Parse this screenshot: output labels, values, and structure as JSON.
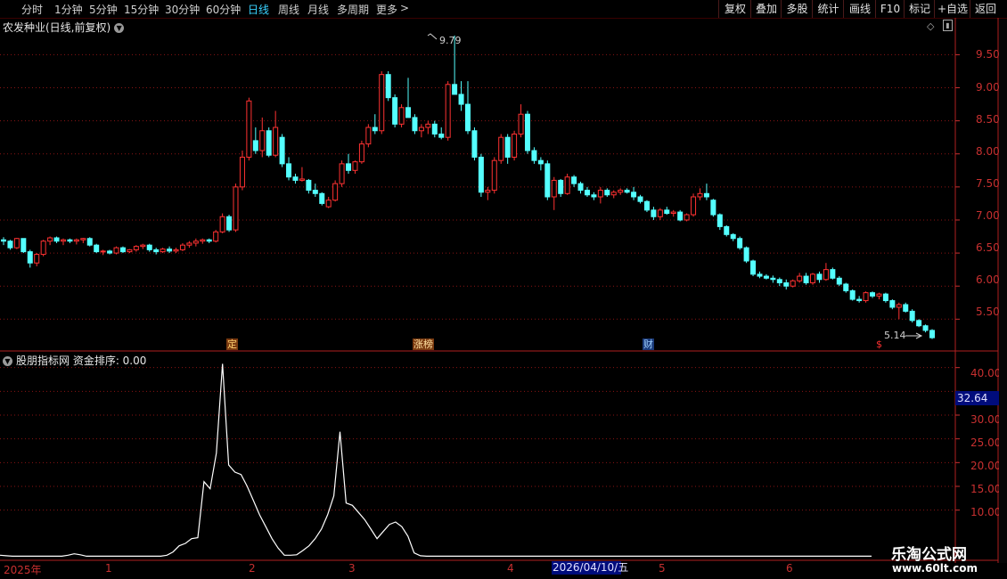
{
  "toolbar": {
    "periods": [
      "分时",
      "1分钟",
      "5分钟",
      "15分钟",
      "30分钟",
      "60分钟",
      "日线",
      "周线",
      "月线",
      "多周期",
      "更多"
    ],
    "active_period": "日线",
    "more_arrow": ">",
    "right_buttons": [
      "复权",
      "叠加",
      "多股",
      "统计",
      "画线",
      "F10",
      "标记",
      "+自选",
      "返回"
    ]
  },
  "chart": {
    "title": "农发种业(日线,前复权)",
    "price_labels": [
      "9.50",
      "9.00",
      "8.50",
      "8.00",
      "7.50",
      "7.00",
      "6.50",
      "6.00",
      "5.50"
    ],
    "high_label": "9.79",
    "low_label": "5.14",
    "events": [
      "定",
      "涨榜",
      "财",
      "$"
    ],
    "up_color": "#ff3232",
    "down_color": "#54ffff",
    "chart_data": {
      "type": "candlestick",
      "series": [
        {
          "ohlc": [
            [
              6.7,
              6.74,
              6.62,
              6.68
            ],
            [
              6.68,
              6.7,
              6.55,
              6.58
            ],
            [
              6.58,
              6.73,
              6.56,
              6.72
            ],
            [
              6.72,
              6.72,
              6.5,
              6.52
            ],
            [
              6.52,
              6.55,
              6.28,
              6.35
            ],
            [
              6.35,
              6.5,
              6.3,
              6.48
            ],
            [
              6.48,
              6.7,
              6.45,
              6.68
            ],
            [
              6.68,
              6.75,
              6.62,
              6.73
            ],
            [
              6.73,
              6.75,
              6.65,
              6.68
            ],
            [
              6.68,
              6.72,
              6.62,
              6.7
            ],
            [
              6.7,
              6.72,
              6.65,
              6.68
            ],
            [
              6.68,
              6.72,
              6.63,
              6.7
            ],
            [
              6.7,
              6.73,
              6.65,
              6.72
            ],
            [
              6.72,
              6.74,
              6.6,
              6.62
            ],
            [
              6.62,
              6.64,
              6.5,
              6.52
            ],
            [
              6.52,
              6.55,
              6.47,
              6.53
            ],
            [
              6.53,
              6.55,
              6.48,
              6.5
            ],
            [
              6.5,
              6.6,
              6.48,
              6.58
            ],
            [
              6.58,
              6.6,
              6.5,
              6.52
            ],
            [
              6.52,
              6.56,
              6.5,
              6.55
            ],
            [
              6.55,
              6.62,
              6.52,
              6.6
            ],
            [
              6.6,
              6.64,
              6.56,
              6.62
            ],
            [
              6.62,
              6.64,
              6.52,
              6.55
            ],
            [
              6.55,
              6.58,
              6.48,
              6.52
            ],
            [
              6.52,
              6.58,
              6.5,
              6.56
            ],
            [
              6.56,
              6.6,
              6.5,
              6.53
            ],
            [
              6.53,
              6.58,
              6.5,
              6.55
            ],
            [
              6.55,
              6.65,
              6.53,
              6.62
            ],
            [
              6.62,
              6.68,
              6.58,
              6.65
            ],
            [
              6.65,
              6.72,
              6.6,
              6.68
            ],
            [
              6.68,
              6.72,
              6.64,
              6.7
            ],
            [
              6.7,
              6.72,
              6.65,
              6.68
            ],
            [
              6.68,
              6.85,
              6.66,
              6.82
            ],
            [
              6.82,
              7.1,
              6.8,
              7.05
            ],
            [
              7.05,
              7.08,
              6.82,
              6.85
            ],
            [
              6.85,
              7.55,
              6.82,
              7.5
            ],
            [
              7.5,
              8.05,
              7.45,
              7.95
            ],
            [
              7.95,
              8.85,
              7.9,
              8.8
            ],
            [
              8.2,
              8.4,
              8.0,
              8.05
            ],
            [
              8.05,
              8.55,
              7.95,
              8.35
            ],
            [
              8.35,
              8.4,
              7.95,
              7.98
            ],
            [
              7.98,
              8.65,
              7.95,
              8.4
            ],
            [
              8.25,
              8.3,
              7.8,
              7.85
            ],
            [
              7.85,
              7.95,
              7.6,
              7.65
            ],
            [
              7.65,
              7.7,
              7.55,
              7.6
            ],
            [
              7.6,
              7.8,
              7.58,
              7.62
            ],
            [
              7.6,
              7.62,
              7.4,
              7.45
            ],
            [
              7.45,
              7.55,
              7.35,
              7.4
            ],
            [
              7.4,
              7.42,
              7.22,
              7.25
            ],
            [
              7.2,
              7.35,
              7.18,
              7.3
            ],
            [
              7.3,
              7.6,
              7.28,
              7.55
            ],
            [
              7.55,
              7.9,
              7.5,
              7.85
            ],
            [
              7.85,
              8.0,
              7.7,
              7.75
            ],
            [
              7.75,
              7.9,
              7.7,
              7.88
            ],
            [
              7.88,
              8.2,
              7.85,
              8.15
            ],
            [
              8.15,
              8.45,
              8.1,
              8.4
            ],
            [
              8.4,
              8.6,
              8.3,
              8.35
            ],
            [
              8.35,
              9.25,
              8.3,
              9.2
            ],
            [
              9.2,
              9.25,
              8.8,
              8.85
            ],
            [
              8.85,
              8.9,
              8.4,
              8.45
            ],
            [
              8.45,
              8.75,
              8.4,
              8.7
            ],
            [
              8.7,
              9.15,
              8.65,
              8.55
            ],
            [
              8.55,
              8.6,
              8.3,
              8.35
            ],
            [
              8.35,
              8.45,
              8.25,
              8.4
            ],
            [
              8.4,
              8.5,
              8.3,
              8.45
            ],
            [
              8.45,
              8.5,
              8.25,
              8.3
            ],
            [
              8.3,
              8.4,
              8.22,
              8.25
            ],
            [
              8.25,
              9.1,
              8.2,
              9.05
            ],
            [
              9.05,
              9.79,
              8.9,
              8.9
            ],
            [
              8.9,
              9.1,
              8.65,
              8.75
            ],
            [
              8.75,
              9.1,
              8.3,
              8.35
            ],
            [
              8.35,
              8.4,
              7.9,
              7.95
            ],
            [
              7.95,
              8.0,
              7.35,
              7.42
            ],
            [
              7.42,
              7.5,
              7.3,
              7.45
            ],
            [
              7.45,
              7.95,
              7.4,
              7.9
            ],
            [
              7.9,
              8.3,
              7.85,
              8.25
            ],
            [
              8.25,
              8.3,
              7.85,
              7.95
            ],
            [
              7.95,
              8.35,
              7.9,
              8.3
            ],
            [
              8.3,
              8.75,
              8.25,
              8.6
            ],
            [
              8.6,
              8.65,
              8.0,
              8.05
            ],
            [
              8.05,
              8.1,
              7.85,
              7.9
            ],
            [
              7.9,
              7.95,
              7.75,
              7.85
            ],
            [
              7.85,
              7.9,
              7.3,
              7.35
            ],
            [
              7.35,
              7.65,
              7.15,
              7.6
            ],
            [
              7.6,
              7.62,
              7.35,
              7.4
            ],
            [
              7.4,
              7.7,
              7.38,
              7.65
            ],
            [
              7.65,
              7.68,
              7.5,
              7.55
            ],
            [
              7.55,
              7.58,
              7.4,
              7.45
            ],
            [
              7.45,
              7.5,
              7.35,
              7.38
            ],
            [
              7.38,
              7.42,
              7.3,
              7.35
            ],
            [
              7.35,
              7.5,
              7.25,
              7.45
            ],
            [
              7.45,
              7.48,
              7.35,
              7.38
            ],
            [
              7.38,
              7.45,
              7.33,
              7.42
            ],
            [
              7.42,
              7.48,
              7.38,
              7.45
            ],
            [
              7.45,
              7.48,
              7.4,
              7.42
            ],
            [
              7.42,
              7.5,
              7.3,
              7.35
            ],
            [
              7.35,
              7.38,
              7.25,
              7.28
            ],
            [
              7.28,
              7.3,
              7.12,
              7.15
            ],
            [
              7.15,
              7.2,
              7.0,
              7.05
            ],
            [
              7.05,
              7.18,
              7.0,
              7.15
            ],
            [
              7.15,
              7.2,
              7.08,
              7.1
            ],
            [
              7.1,
              7.15,
              7.05,
              7.12
            ],
            [
              7.12,
              7.15,
              6.98,
              7.0
            ],
            [
              7.0,
              7.1,
              6.98,
              7.08
            ],
            [
              7.08,
              7.4,
              7.05,
              7.35
            ],
            [
              7.35,
              7.48,
              7.3,
              7.4
            ],
            [
              7.4,
              7.55,
              7.3,
              7.35
            ],
            [
              7.3,
              7.32,
              7.05,
              7.08
            ],
            [
              7.08,
              7.1,
              6.85,
              6.9
            ],
            [
              6.9,
              6.92,
              6.75,
              6.78
            ],
            [
              6.78,
              6.8,
              6.68,
              6.72
            ],
            [
              6.72,
              6.75,
              6.55,
              6.58
            ],
            [
              6.58,
              6.6,
              6.35,
              6.38
            ],
            [
              6.38,
              6.4,
              6.15,
              6.18
            ],
            [
              6.18,
              6.22,
              6.12,
              6.15
            ],
            [
              6.15,
              6.18,
              6.1,
              6.12
            ],
            [
              6.12,
              6.16,
              6.05,
              6.1
            ],
            [
              6.1,
              6.13,
              6.0,
              6.05
            ],
            [
              6.05,
              6.1,
              5.95,
              6.0
            ],
            [
              6.0,
              6.1,
              5.98,
              6.08
            ],
            [
              6.08,
              6.2,
              6.05,
              6.15
            ],
            [
              6.15,
              6.2,
              6.02,
              6.05
            ],
            [
              6.05,
              6.2,
              6.02,
              6.18
            ],
            [
              6.18,
              6.22,
              6.05,
              6.1
            ],
            [
              6.1,
              6.35,
              6.08,
              6.25
            ],
            [
              6.25,
              6.28,
              6.1,
              6.12
            ],
            [
              6.12,
              6.15,
              6.0,
              6.03
            ],
            [
              6.03,
              6.05,
              5.9,
              5.93
            ],
            [
              5.93,
              5.95,
              5.78,
              5.8
            ],
            [
              5.8,
              5.85,
              5.75,
              5.78
            ],
            [
              5.78,
              5.92,
              5.75,
              5.9
            ],
            [
              5.9,
              5.92,
              5.82,
              5.85
            ],
            [
              5.85,
              5.9,
              5.8,
              5.88
            ],
            [
              5.88,
              5.9,
              5.75,
              5.78
            ],
            [
              5.78,
              5.8,
              5.65,
              5.68
            ],
            [
              5.68,
              5.75,
              5.5,
              5.72
            ],
            [
              5.72,
              5.75,
              5.6,
              5.62
            ],
            [
              5.62,
              5.65,
              5.45,
              5.48
            ],
            [
              5.48,
              5.5,
              5.38,
              5.4
            ],
            [
              5.4,
              5.42,
              5.3,
              5.33
            ],
            [
              5.33,
              5.35,
              5.2,
              5.22
            ]
          ]
        }
      ],
      "ylim": [
        5.1,
        9.95
      ]
    }
  },
  "indicator": {
    "title": "股朋指标网 资金排序: 0.00",
    "axis_labels": [
      "40.00",
      "35.00",
      "30.00",
      "25.00",
      "20.00",
      "15.00",
      "10.00"
    ],
    "current_value": "32.64",
    "chart_data": {
      "type": "line",
      "ylim": [
        0,
        42
      ],
      "series": [
        {
          "values": [
            0.5,
            0.4,
            0.3,
            0.3,
            0.3,
            0.3,
            0.3,
            0.3,
            0.3,
            0.3,
            0.3,
            0.5,
            0.8,
            0.6,
            0.3,
            0.3,
            0.3,
            0.3,
            0.3,
            0.3,
            0.3,
            0.3,
            0.3,
            0.3,
            0.3,
            0.3,
            0.3,
            0.5,
            1.2,
            2.5,
            3.0,
            4.0,
            4.2,
            16.0,
            14.5,
            22.0,
            40.8,
            19.5,
            18.0,
            17.5,
            15.0,
            12.0,
            9.0,
            6.5,
            4.0,
            2.0,
            0.5,
            0.5,
            0.6,
            1.5,
            2.5,
            4.0,
            6.0,
            9.0,
            13.0,
            26.5,
            11.5,
            11.0,
            9.5,
            8.0,
            6.0,
            4.0,
            5.5,
            7.0,
            7.5,
            6.5,
            4.5,
            1.0,
            0.4,
            0.3,
            0.3,
            0.3,
            0.3,
            0.3,
            0.3,
            0.3,
            0.3,
            0.3,
            0.3,
            0.3,
            0.3,
            0.3,
            0.3,
            0.3,
            0.3,
            0.3,
            0.3,
            0.3,
            0.3,
            0.3,
            0.3,
            0.3,
            0.3,
            0.3,
            0.3,
            0.3,
            0.3,
            0.3,
            0.3,
            0.3,
            0.3,
            0.3,
            0.3,
            0.3,
            0.3,
            0.3,
            0.3,
            0.3,
            0.3,
            0.3,
            0.3,
            0.3,
            0.3,
            0.3,
            0.3,
            0.3,
            0.3,
            0.3,
            0.3,
            0.3,
            0.3,
            0.3,
            0.3,
            0.3,
            0.3,
            0.3,
            0.3,
            0.3,
            0.3,
            0.3,
            0.3,
            0.3,
            0.3,
            0.3,
            0.3,
            0.3,
            0.3,
            0.3,
            0.3,
            0.3,
            0.3,
            0.3
          ]
        }
      ]
    }
  },
  "date_axis": {
    "labels": [
      "2025年",
      "1",
      "2",
      "3",
      "4",
      "5",
      "6"
    ],
    "cursor_date": "2026/04/10/五"
  },
  "watermark": {
    "line1": "乐淘公式网",
    "line2": "www.60lt.com"
  }
}
